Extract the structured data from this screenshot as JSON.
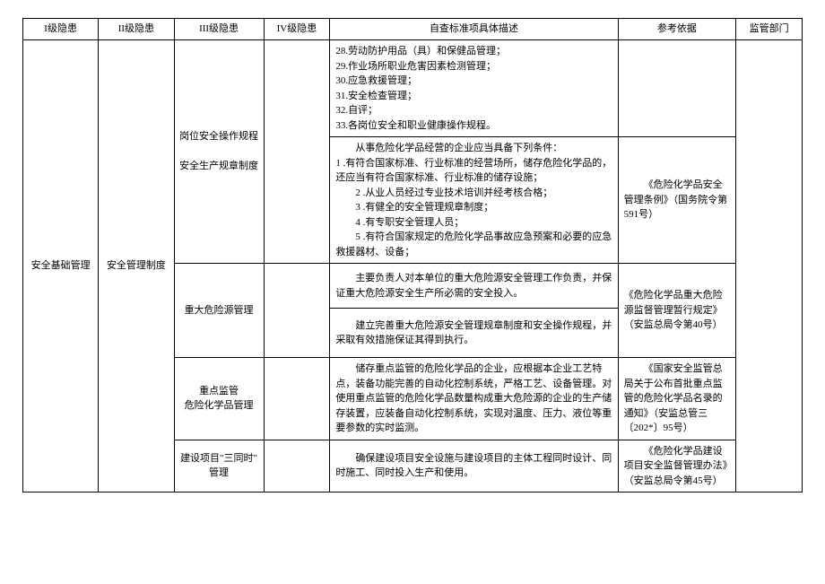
{
  "headers": {
    "col1": "I级隐患",
    "col2": "II级隐患",
    "col3": "III级隐患",
    "col4": "IV级隐患",
    "col5": "自查标准项具体描述",
    "col6": "参考依据",
    "col7": "监管部门"
  },
  "lvl1": "安全基础管理",
  "lvl2": "安全管理制度",
  "r1": {
    "lvl3a": "岗位安全操作规程",
    "lvl3b": "安全生产规章制度",
    "desc1_l1": "28.劳动防护用品（具）和保健品管理；",
    "desc1_l2": "29.作业场所职业危害因素检测管理；",
    "desc1_l3": "30.应急救援管理；",
    "desc1_l4": "31.安全检查管理；",
    "desc1_l5": "32.自评；",
    "desc1_l6": "33.各岗位安全和职业健康操作规程。",
    "desc2_l1": "从事危险化学品经营的企业应当具备下列条件：",
    "desc2_l2": "1  .有符合国家标准、行业标准的经营场所，储存危险化学品的，还应当有符合国家标准、行业标准的储存设施；",
    "desc2_l3": "2    .从业人员经过专业技术培训并经考核合格；",
    "desc2_l4": "3    .有健全的安全管理规章制度；",
    "desc2_l5": "4    .有专职安全管理人员；",
    "desc2_l6": "5  .有符合国家规定的危险化学品事故应急预案和必要的应急救援器材、设备；",
    "ref": "《危险化学品安全管理条例》（国务院令第591号）"
  },
  "r2": {
    "lvl3": "重大危险源管理",
    "desc1": "主要负责人对本单位的重大危险源安全管理工作负责，并保证重大危险源安全生产所必需的安全投入。",
    "desc2": "建立完善重大危险源安全管理规章制度和安全操作规程，并采取有效措施保证其得到执行。",
    "ref": "《危险化学品重大危险源监督管理暂行规定》（安监总局令第40号）"
  },
  "r3": {
    "lvl3a": "重点监管",
    "lvl3b": "危险化学品管理",
    "desc": "储存重点监管的危险化学品的企业，应根据本企业工艺特点，装备功能完善的自动化控制系统，严格工艺、设备管理。对使用重点监管的危险化学品数量构成重大危险源的企业的生产储存装置，应装备自动化控制系统，实现对温度、压力、液位等重要参数的实时监测。",
    "ref": "《国家安全监管总局关于公布首批重点监管的危险化学品名录的通知》（安监总管三〔202*〕95号）"
  },
  "r4": {
    "lvl3a": "建设项目\"三同时\"",
    "lvl3b": "管理",
    "desc": "确保建设项目安全设施与建设项目的主体工程同时设计、同时施工、同时投入生产和使用。",
    "ref": "《危险化学品建设项目安全监督管理办法》",
    "ref2": "（安监总局令第45号）"
  }
}
